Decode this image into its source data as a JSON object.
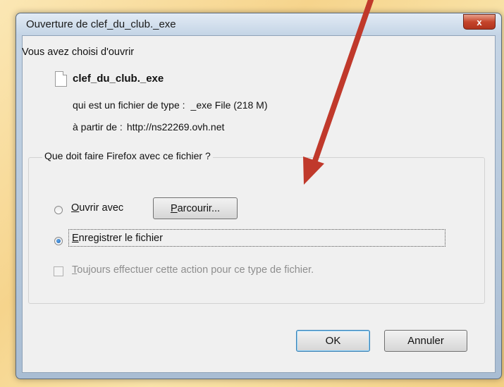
{
  "dialog": {
    "title": "Ouverture de clef_du_club._exe",
    "close_glyph": "x"
  },
  "info": {
    "chosen_label": "Vous avez choisi d'ouvrir",
    "filename": "clef_du_club._exe",
    "type_label": "qui est un fichier de type :",
    "type_value": "_exe File (218  M",
    "type_value_end": ")",
    "from_label": "à partir de :",
    "from_value": "http://ns22269.ovh.net"
  },
  "action_group": {
    "label": "Que doit faire Firefox avec ce fichier ?",
    "open_with": {
      "first_letter": "O",
      "rest": "uvrir avec",
      "selected": false
    },
    "browse_button": {
      "first_letter": "P",
      "rest": "arcourir..."
    },
    "save_file": {
      "first_letter": "E",
      "rest": "nregistrer le fichier",
      "selected": true
    },
    "always": {
      "first_letter": "T",
      "rest": "oujours effectuer cette action pour ce type de fichier.",
      "checked": false,
      "enabled": false
    }
  },
  "buttons": {
    "ok": "OK",
    "cancel": "Annuler"
  },
  "colors": {
    "arrow": "#c0392b",
    "background": "#f6d48c"
  }
}
